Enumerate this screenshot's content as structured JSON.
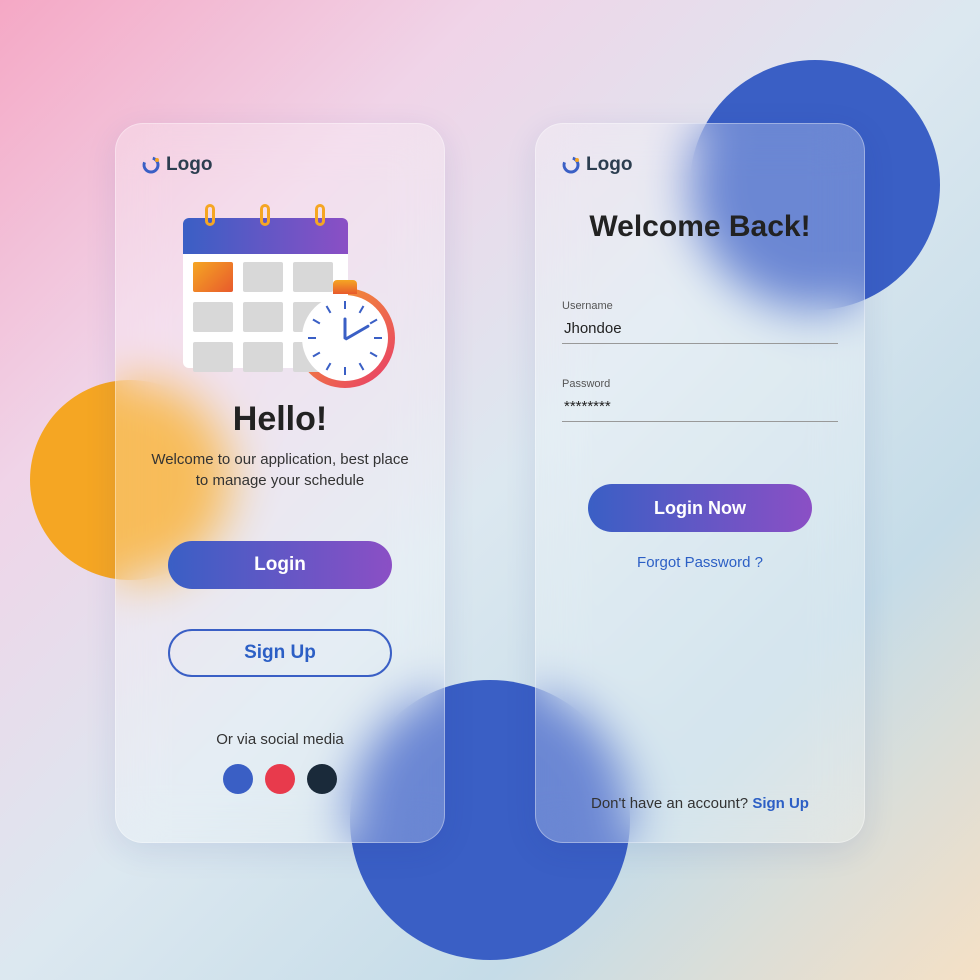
{
  "brand": {
    "name": "Logo"
  },
  "colors": {
    "primary": "#3a5fc5",
    "accent": "#8b4fc5",
    "orange": "#f5a623"
  },
  "welcome": {
    "title": "Hello!",
    "subtitle": "Welcome to our application, best place to manage your schedule",
    "login_label": "Login",
    "signup_label": "Sign Up",
    "social_label": "Or via social media",
    "social": [
      "facebook",
      "google",
      "apple"
    ]
  },
  "login": {
    "title": "Welcome Back!",
    "username_label": "Username",
    "username_value": "Jhondoe",
    "password_label": "Password",
    "password_value": "********",
    "submit_label": "Login Now",
    "forgot_label": "Forgot Password ?",
    "footer_text": "Don't have an account? ",
    "footer_link": "Sign Up"
  }
}
